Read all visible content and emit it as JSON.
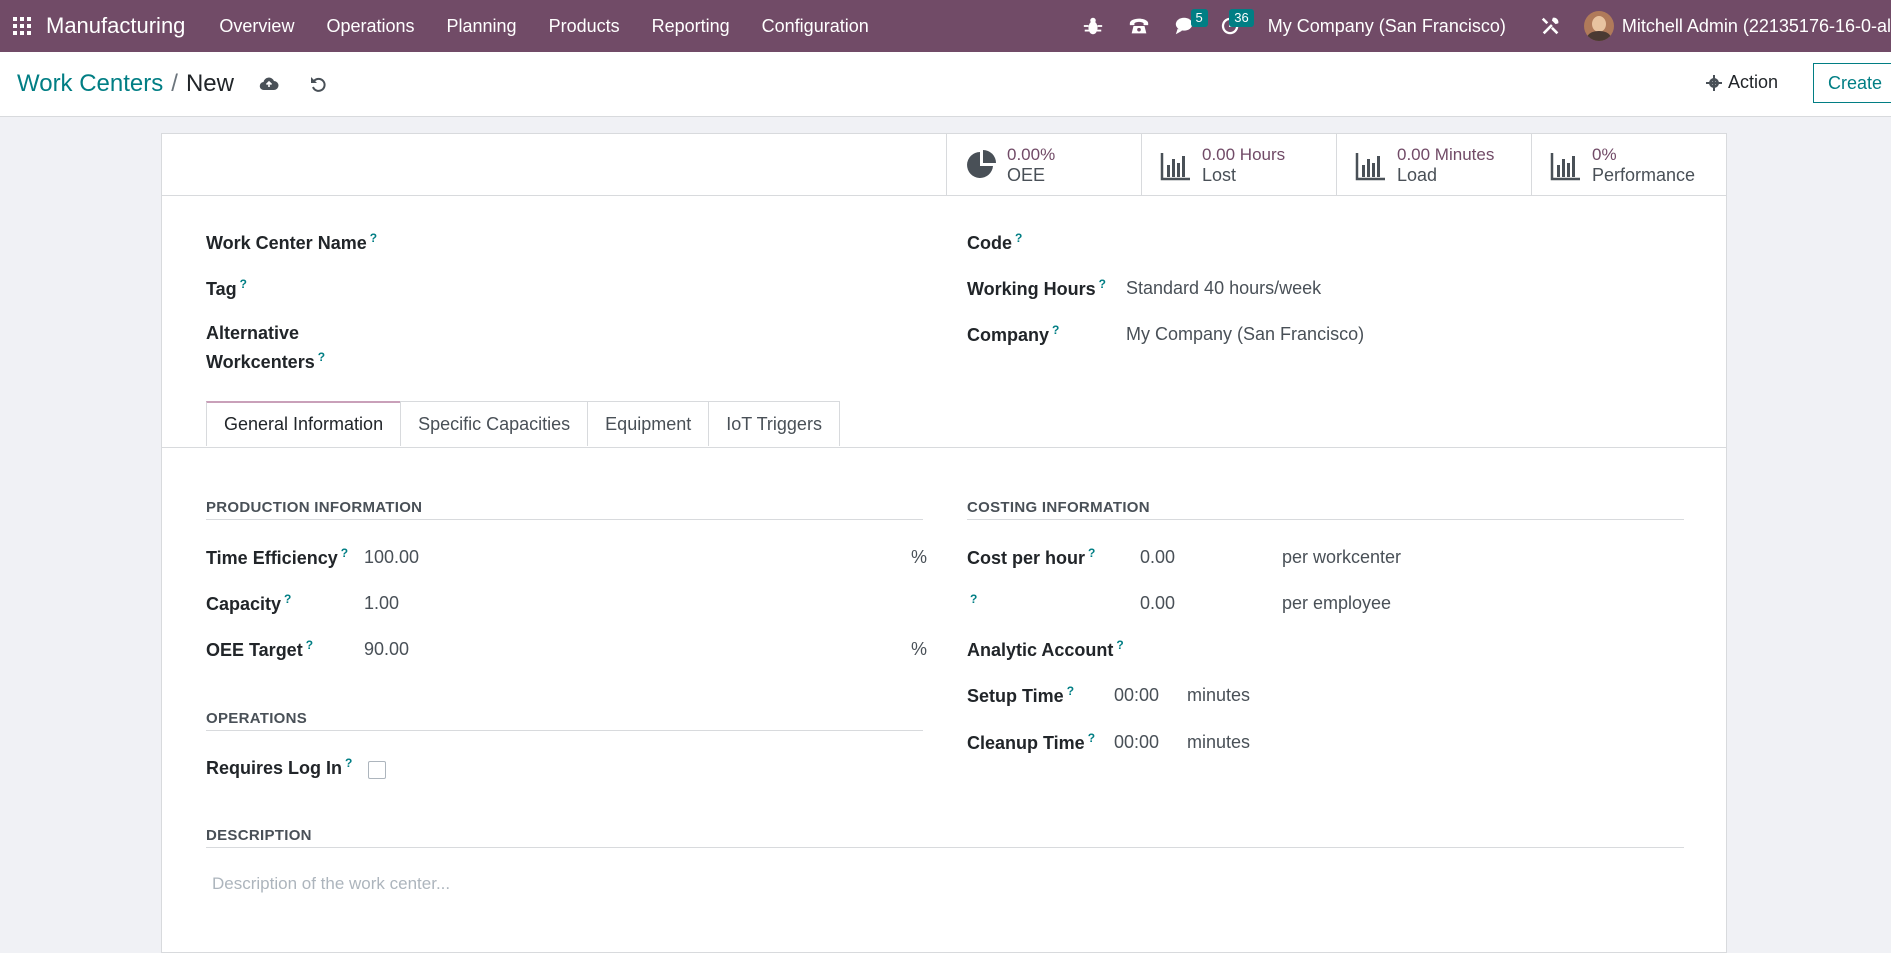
{
  "navbar": {
    "app_name": "Manufacturing",
    "menu": [
      "Overview",
      "Operations",
      "Planning",
      "Products",
      "Reporting",
      "Configuration"
    ],
    "messages_count": "5",
    "activities_count": "36",
    "company": "My Company (San Francisco)",
    "user": "Mitchell Admin (22135176-16-0-al"
  },
  "control": {
    "breadcrumb_parent": "Work Centers",
    "breadcrumb_separator": "/",
    "breadcrumb_current": "New",
    "action_label": "Action",
    "create_label": "Create"
  },
  "stats": [
    {
      "value": "0.00%",
      "label": "OEE",
      "icon": "pie-chart-icon"
    },
    {
      "value": "0.00 Hours",
      "label": "Lost",
      "icon": "bar-chart-icon"
    },
    {
      "value": "0.00 Minutes",
      "label": "Load",
      "icon": "bar-chart-icon"
    },
    {
      "value": "0%",
      "label": "Performance",
      "icon": "bar-chart-icon"
    }
  ],
  "form": {
    "work_center_name_label": "Work Center Name",
    "tag_label": "Tag",
    "alt_wc_label_1": "Alternative",
    "alt_wc_label_2": "Workcenters",
    "code_label": "Code",
    "working_hours_label": "Working Hours",
    "working_hours_value": "Standard 40 hours/week",
    "company_label": "Company",
    "company_value": "My Company (San Francisco)",
    "help_mark": "?"
  },
  "tabs": [
    "General Information",
    "Specific Capacities",
    "Equipment",
    "IoT Triggers"
  ],
  "production": {
    "title": "PRODUCTION INFORMATION",
    "time_efficiency_label": "Time Efficiency",
    "time_efficiency_value": "100.00",
    "capacity_label": "Capacity",
    "capacity_value": "1.00",
    "oee_target_label": "OEE Target",
    "oee_target_value": "90.00",
    "percent": "%"
  },
  "operations": {
    "title": "OPERATIONS",
    "requires_login_label": "Requires Log In",
    "requires_login_checked": false
  },
  "costing": {
    "title": "COSTING INFORMATION",
    "cost_per_hour_label": "Cost per hour",
    "cost_per_hour_value": "0.00",
    "per_workcenter": "per workcenter",
    "employee_cost_value": "0.00",
    "per_employee": "per employee",
    "analytic_account_label": "Analytic Account",
    "setup_time_label": "Setup Time",
    "setup_time_value": "00:00",
    "cleanup_time_label": "Cleanup Time",
    "cleanup_time_value": "00:00",
    "minutes": "minutes"
  },
  "description": {
    "title": "DESCRIPTION",
    "placeholder": "Description of the work center..."
  },
  "colors": {
    "navbar": "#714b67",
    "accent": "#017e84",
    "stat_value": "#714b67"
  }
}
